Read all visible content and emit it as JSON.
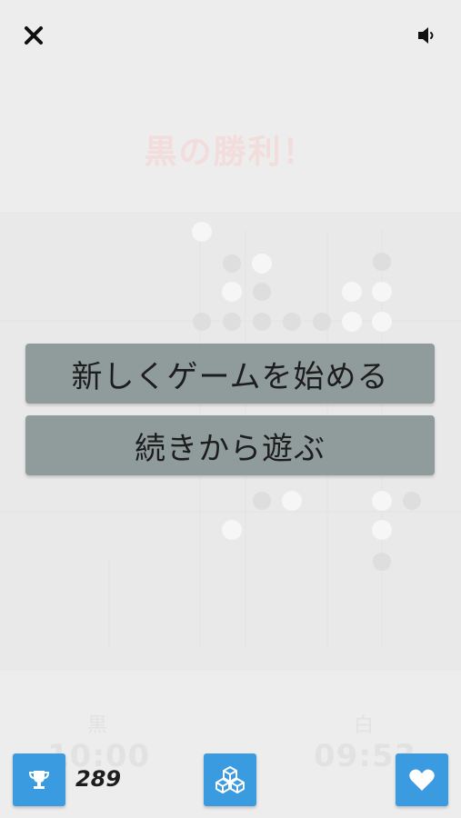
{
  "header": {
    "close_icon": "close-x-icon",
    "sound_icon": "speaker-icon"
  },
  "result_text": "黒の勝利！",
  "menu": {
    "new_game_label": "新しくゲームを始める",
    "continue_label": "続きから遊ぶ"
  },
  "players": {
    "black": {
      "name": "黒",
      "time": "10:00"
    },
    "white": {
      "name": "白",
      "time": "09:53"
    }
  },
  "footer": {
    "trophy_icon": "trophy-icon",
    "score": "289",
    "blocks_icon": "blocks-icon",
    "heart_icon": "heart-icon"
  },
  "colors": {
    "accent": "#3b9be0",
    "menu_button": "#909b9b",
    "result_text": "#f3dcdc"
  }
}
